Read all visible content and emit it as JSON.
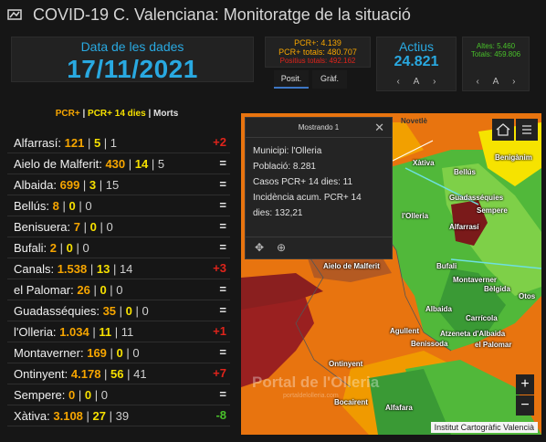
{
  "header": {
    "title": "COVID-19 C. Valenciana: Monitoratge de la situació"
  },
  "date_card": {
    "label": "Data de les dades",
    "value": "17/11/2021"
  },
  "pcr_card": {
    "line1": "PCR+: 4.139",
    "line2": "PCR+ totals: 480.707",
    "line3": "Positius totals: 492.162"
  },
  "tabs": [
    "Posit.",
    "Gràf."
  ],
  "actius": {
    "label": "Actius",
    "value": "24.821",
    "prev": "‹",
    "page": "A",
    "next": "›"
  },
  "altes": {
    "line1": "Altes: 5.460",
    "line2": "Totals: 459.806",
    "prev": "‹",
    "page": "A",
    "next": "›"
  },
  "list": {
    "header": {
      "a": "PCR+",
      "sep1": " | ",
      "b": "PCR+ 14 dies",
      "sep2": " | ",
      "c": "Morts"
    },
    "rows": [
      {
        "name": "Alfarrasí:",
        "v1": "121",
        "v2": "5",
        "v3": "1",
        "trend": "+2",
        "kind": "up"
      },
      {
        "name": "Aielo de Malferit:",
        "v1": "430",
        "v2": "14",
        "v3": "5",
        "trend": "=",
        "kind": "eq"
      },
      {
        "name": "Albaida:",
        "v1": "699",
        "v2": "3",
        "v3": "15",
        "trend": "=",
        "kind": "eq"
      },
      {
        "name": "Bellús:",
        "v1": "8",
        "v2": "0",
        "v3": "0",
        "trend": "=",
        "kind": "eq"
      },
      {
        "name": "Benisuera:",
        "v1": "7",
        "v2": "0",
        "v3": "0",
        "trend": "=",
        "kind": "eq"
      },
      {
        "name": "Bufali:",
        "v1": "2",
        "v2": "0",
        "v3": "0",
        "trend": "=",
        "kind": "eq"
      },
      {
        "name": "Canals:",
        "v1": "1.538",
        "v2": "13",
        "v3": "14",
        "trend": "+3",
        "kind": "up"
      },
      {
        "name": "el Palomar:",
        "v1": "26",
        "v2": "0",
        "v3": "0",
        "trend": "=",
        "kind": "eq"
      },
      {
        "name": "Guadasséquies:",
        "v1": "35",
        "v2": "0",
        "v3": "0",
        "trend": "=",
        "kind": "eq"
      },
      {
        "name": "l'Olleria:",
        "v1": "1.034",
        "v2": "11",
        "v3": "11",
        "trend": "+1",
        "kind": "up"
      },
      {
        "name": "Montaverner:",
        "v1": "169",
        "v2": "0",
        "v3": "0",
        "trend": "=",
        "kind": "eq"
      },
      {
        "name": "Ontinyent:",
        "v1": "4.178",
        "v2": "56",
        "v3": "41",
        "trend": "+7",
        "kind": "up"
      },
      {
        "name": "Sempere:",
        "v1": "0",
        "v2": "0",
        "v3": "0",
        "trend": "=",
        "kind": "eq"
      },
      {
        "name": "Xàtiva:",
        "v1": "3.108",
        "v2": "27",
        "v3": "39",
        "trend": "-8",
        "kind": "down"
      }
    ]
  },
  "popup": {
    "title": "Mostrando 1",
    "lines": [
      "Municipi: l'Olleria",
      "Població: 8.281",
      "Casos PCR+ 14 dies: 11",
      "Incidència acum. PCR+ 14",
      "dies: 132,21"
    ]
  },
  "map": {
    "labels": [
      "Novetlè",
      "Xàtiva",
      "Bellús",
      "Guadasséquies",
      "Sempere",
      "l'Olleria",
      "Alfarrasí",
      "Bufali",
      "Montaverner",
      "Aielo de Malferit",
      "Albaida",
      "Bèlgida",
      "Otos",
      "Carrícola",
      "Atzeneta d'Albaida",
      "el Palomar",
      "Agullent",
      "Benissoda",
      "Ontinyent",
      "Bocairent",
      "Alfafara",
      "Benigànim",
      "Genovés",
      "Quatretonda",
      "Bufali"
    ],
    "watermark": "Portal de l'Olleria",
    "watermark_sub": "portaldelolleria.com",
    "attribution": "Institut Cartogràfic Valencià",
    "zoom_in": "+",
    "zoom_out": "−"
  }
}
